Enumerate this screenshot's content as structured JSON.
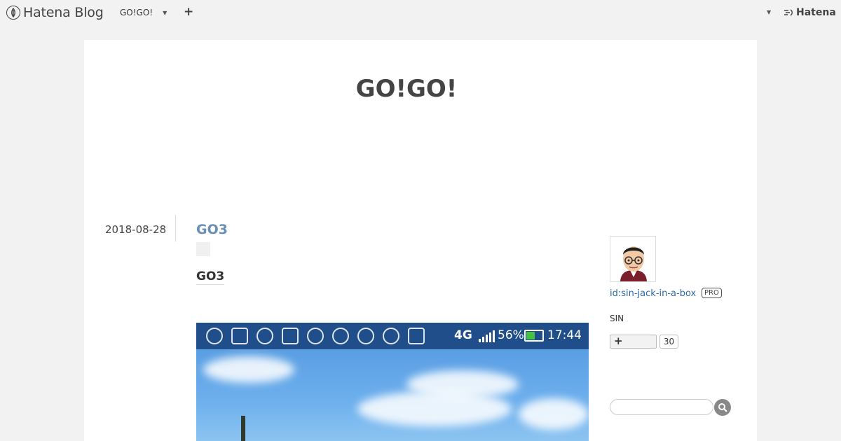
{
  "topbar": {
    "brand": "Hatena Blog",
    "blog_name": "GO!GO!",
    "add_label": "+",
    "hatena_label": "Hatena"
  },
  "blog": {
    "title": "GO!GO!"
  },
  "entry": {
    "date": "2018-08-28",
    "title": "GO3",
    "heading": "GO3",
    "status_bar": {
      "network": "4G",
      "battery_percent": "56%",
      "time": "17:44"
    }
  },
  "sidebar": {
    "user_id": "id:sin-jack-in-a-box",
    "pro_badge": "PRO",
    "user_name": "SIN",
    "follow_label": "+",
    "follow_count": "30",
    "search_placeholder": ""
  },
  "colors": {
    "background": "#f2f2f2",
    "panel": "#ffffff",
    "link": "#2a6aa8",
    "entry_title": "#6a8fb5",
    "status_bar": "#1f4e8a"
  }
}
